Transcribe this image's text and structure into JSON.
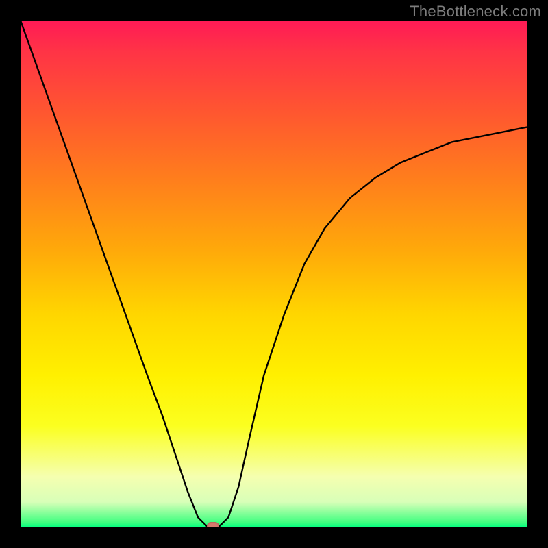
{
  "watermark": "TheBottleneck.com",
  "chart_data": {
    "type": "line",
    "title": "",
    "xlabel": "",
    "ylabel": "",
    "xlim": [
      0,
      100
    ],
    "ylim": [
      0,
      100
    ],
    "series": [
      {
        "name": "bottleneck-curve",
        "x": [
          0,
          5,
          10,
          15,
          20,
          25,
          28,
          31,
          33,
          35,
          37,
          39,
          41,
          43,
          45,
          48,
          52,
          56,
          60,
          65,
          70,
          75,
          80,
          85,
          90,
          95,
          100
        ],
        "y": [
          100,
          86,
          72,
          58,
          44,
          30,
          22,
          13,
          7,
          2,
          0,
          0,
          2,
          8,
          17,
          30,
          42,
          52,
          59,
          65,
          69,
          72,
          74,
          76,
          77,
          78,
          79
        ]
      }
    ],
    "marker": {
      "x": 38,
      "y": 0,
      "color": "#d87a6e"
    },
    "gradient_stops": [
      {
        "pos": 0.0,
        "color": "#ff1a56"
      },
      {
        "pos": 0.06,
        "color": "#ff3346"
      },
      {
        "pos": 0.18,
        "color": "#ff5630"
      },
      {
        "pos": 0.3,
        "color": "#ff7a1e"
      },
      {
        "pos": 0.45,
        "color": "#ffa80a"
      },
      {
        "pos": 0.58,
        "color": "#ffd600"
      },
      {
        "pos": 0.7,
        "color": "#fff000"
      },
      {
        "pos": 0.8,
        "color": "#fbff20"
      },
      {
        "pos": 0.9,
        "color": "#f5ffb0"
      },
      {
        "pos": 0.95,
        "color": "#d8ffb8"
      },
      {
        "pos": 0.99,
        "color": "#40ff80"
      },
      {
        "pos": 1.0,
        "color": "#00ff80"
      }
    ]
  }
}
